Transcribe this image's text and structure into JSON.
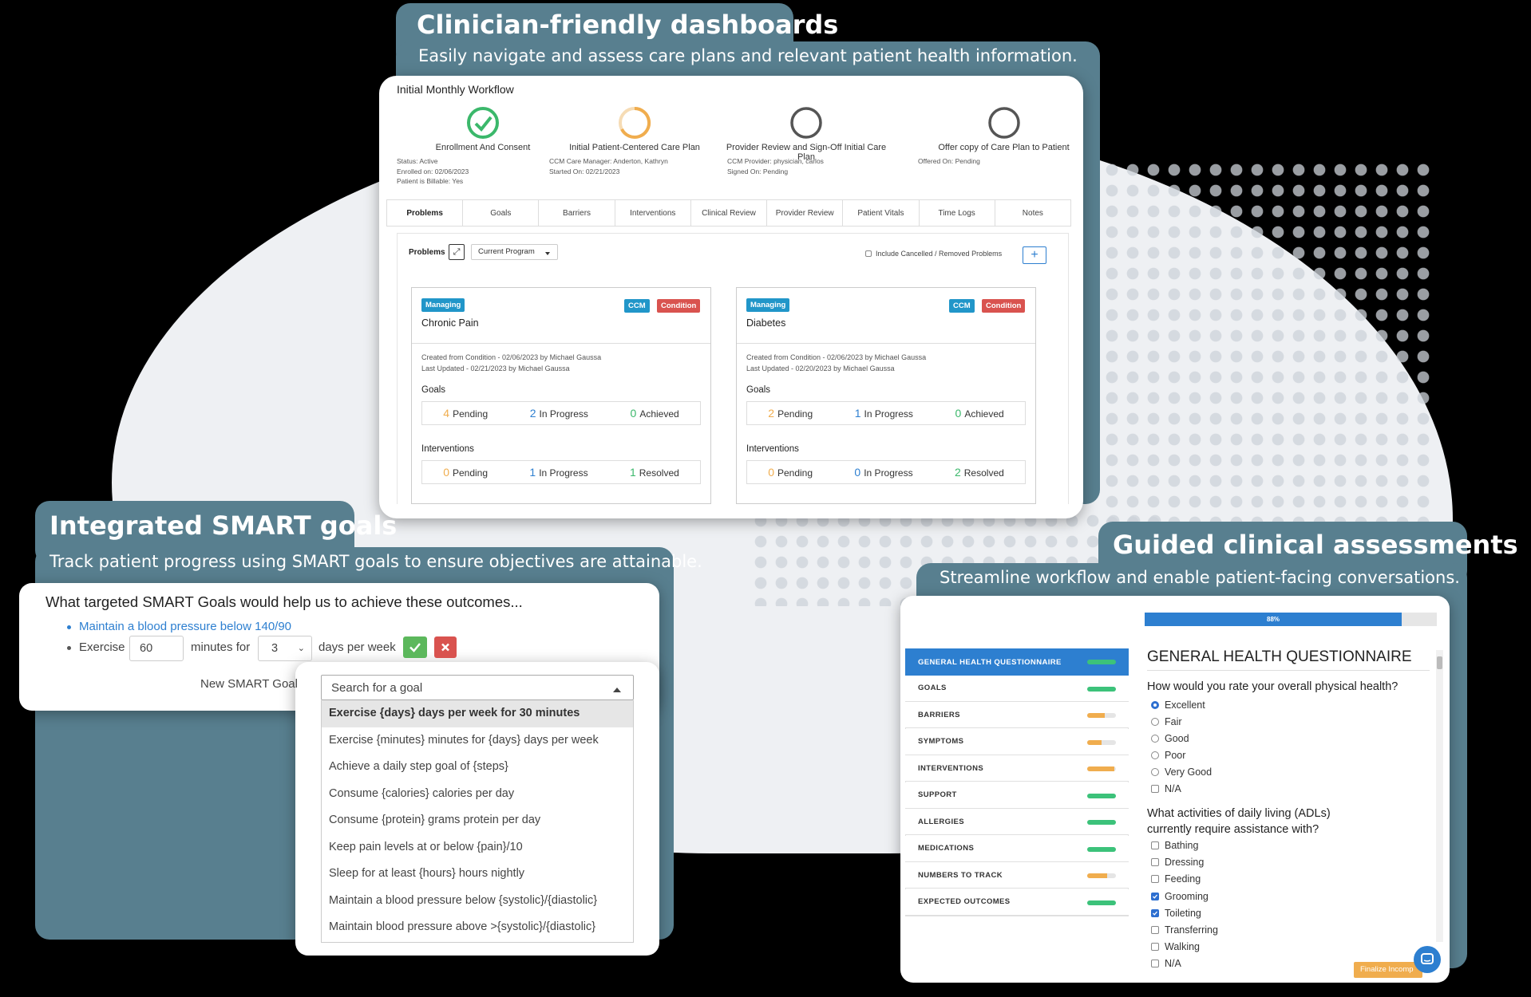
{
  "dashboard": {
    "title": "Clinician-friendly dashboards",
    "subtitle": "Easily navigate and assess care plans and relevant patient health information.",
    "workflow_title": "Initial Monthly Workflow",
    "steps": [
      {
        "label": "Enrollment And Consent",
        "state": "complete",
        "meta": [
          "Status: Active",
          "Enrolled on: 02/06/2023",
          "Patient is Billable: Yes"
        ]
      },
      {
        "label": "Initial Patient-Centered Care Plan",
        "state": "in-progress",
        "meta": [
          "CCM Care Manager: Anderton, Kathryn",
          "Started On: 02/21/2023"
        ]
      },
      {
        "label": "Provider Review and Sign-Off Initial Care Plan",
        "state": "pending",
        "meta": [
          "CCM Provider: physician, carlos",
          "Signed On: Pending"
        ]
      },
      {
        "label": "Offer copy of Care Plan to Patient",
        "state": "pending",
        "meta": [
          "Offered On: Pending"
        ]
      }
    ],
    "tabs": [
      "Problems",
      "Goals",
      "Barriers",
      "Interventions",
      "Clinical Review",
      "Provider Review",
      "Patient Vitals",
      "Time Logs",
      "Notes"
    ],
    "problems_label": "Problems",
    "program_select": "Current Program",
    "include_cancelled": "Include Cancelled / Removed Problems",
    "add_symbol": "+",
    "expand_symbol": "⤢",
    "problems": [
      {
        "status": "Managing",
        "badge1": "CCM",
        "badge2": "Condition",
        "name": "Chronic Pain",
        "created": "Created from Condition - 02/06/2023 by Michael Gaussa",
        "updated": "Last Updated - 02/21/2023 by Michael Gaussa",
        "goals_label": "Goals",
        "goals": [
          {
            "n": "4",
            "label": "Pending"
          },
          {
            "n": "2",
            "label": "In Progress"
          },
          {
            "n": "0",
            "label": "Achieved"
          }
        ],
        "interventions_label": "Interventions",
        "interventions": [
          {
            "n": "0",
            "label": "Pending"
          },
          {
            "n": "1",
            "label": "In Progress"
          },
          {
            "n": "1",
            "label": "Resolved"
          }
        ]
      },
      {
        "status": "Managing",
        "badge1": "CCM",
        "badge2": "Condition",
        "name": "Diabetes",
        "created": "Created from Condition - 02/06/2023 by Michael Gaussa",
        "updated": "Last Updated - 02/20/2023 by Michael Gaussa",
        "goals_label": "Goals",
        "goals": [
          {
            "n": "2",
            "label": "Pending"
          },
          {
            "n": "1",
            "label": "In Progress"
          },
          {
            "n": "0",
            "label": "Achieved"
          }
        ],
        "interventions_label": "Interventions",
        "interventions": [
          {
            "n": "0",
            "label": "Pending"
          },
          {
            "n": "0",
            "label": "In Progress"
          },
          {
            "n": "2",
            "label": "Resolved"
          }
        ]
      }
    ]
  },
  "smart": {
    "title": "Integrated SMART goals",
    "subtitle": "Track patient progress using SMART goals to ensure objectives are attainable.",
    "question": "What targeted SMART Goals would help us to achieve these outcomes...",
    "goal_link": "Maintain a blood pressure below 140/90",
    "exercise_label": "Exercise",
    "minutes_value": "60",
    "minutes_for": "minutes for",
    "days_value": "3",
    "days_per_week": "days per week",
    "new_goal_label": "New SMART Goal",
    "search_placeholder": "Search for a goal",
    "options": [
      "Exercise {days} days per week for 30 minutes",
      "Exercise {minutes} minutes for {days} days per week",
      "Achieve a daily step goal of {steps}",
      "Consume {calories} calories per day",
      "Consume {protein} grams protein per day",
      "Keep pain levels at or below {pain}/10",
      "Sleep for at least {hours} hours nightly",
      "Maintain a blood pressure below {systolic}/{diastolic}",
      "Maintain blood pressure above >{systolic}/{diastolic}"
    ]
  },
  "assess": {
    "title": "Guided clinical assessments",
    "subtitle": "Streamline workflow and enable patient-facing conversations.",
    "progress_label": "88%",
    "progress": 0.88,
    "sections": [
      {
        "label": "GENERAL HEALTH QUESTIONNAIRE",
        "fill": 1.0,
        "color": "#3cc27a"
      },
      {
        "label": "GOALS",
        "fill": 1.0,
        "color": "#3cc27a"
      },
      {
        "label": "BARRIERS",
        "fill": 0.6,
        "color": "#f0ad4e"
      },
      {
        "label": "SYMPTOMS",
        "fill": 0.5,
        "color": "#f0ad4e"
      },
      {
        "label": "INTERVENTIONS",
        "fill": 0.95,
        "color": "#f0ad4e"
      },
      {
        "label": "SUPPORT",
        "fill": 1.0,
        "color": "#3cc27a"
      },
      {
        "label": "ALLERGIES",
        "fill": 1.0,
        "color": "#3cc27a"
      },
      {
        "label": "MEDICATIONS",
        "fill": 1.0,
        "color": "#3cc27a"
      },
      {
        "label": "NUMBERS TO TRACK",
        "fill": 0.7,
        "color": "#f0ad4e"
      },
      {
        "label": "EXPECTED OUTCOMES",
        "fill": 1.0,
        "color": "#3cc27a"
      }
    ],
    "heading": "GENERAL HEALTH QUESTIONNAIRE",
    "q1": "How would you rate your overall physical health?",
    "q1_options": [
      "Excellent",
      "Fair",
      "Good",
      "Poor",
      "Very Good",
      "N/A"
    ],
    "q2_line1": "What activities of daily living (ADLs)",
    "q2_line2": "currently require assistance with?",
    "q2_options": [
      "Bathing",
      "Dressing",
      "Feeding",
      "Grooming",
      "Toileting",
      "Transferring",
      "Walking",
      "N/A"
    ],
    "finalize_label": "Finalize Incomp",
    "colors": {
      "teal": "#587f8f",
      "accent_blue": "#2d7fd0",
      "danger": "#d9534f",
      "success": "#5cb85c",
      "info": "#2196c9"
    }
  }
}
